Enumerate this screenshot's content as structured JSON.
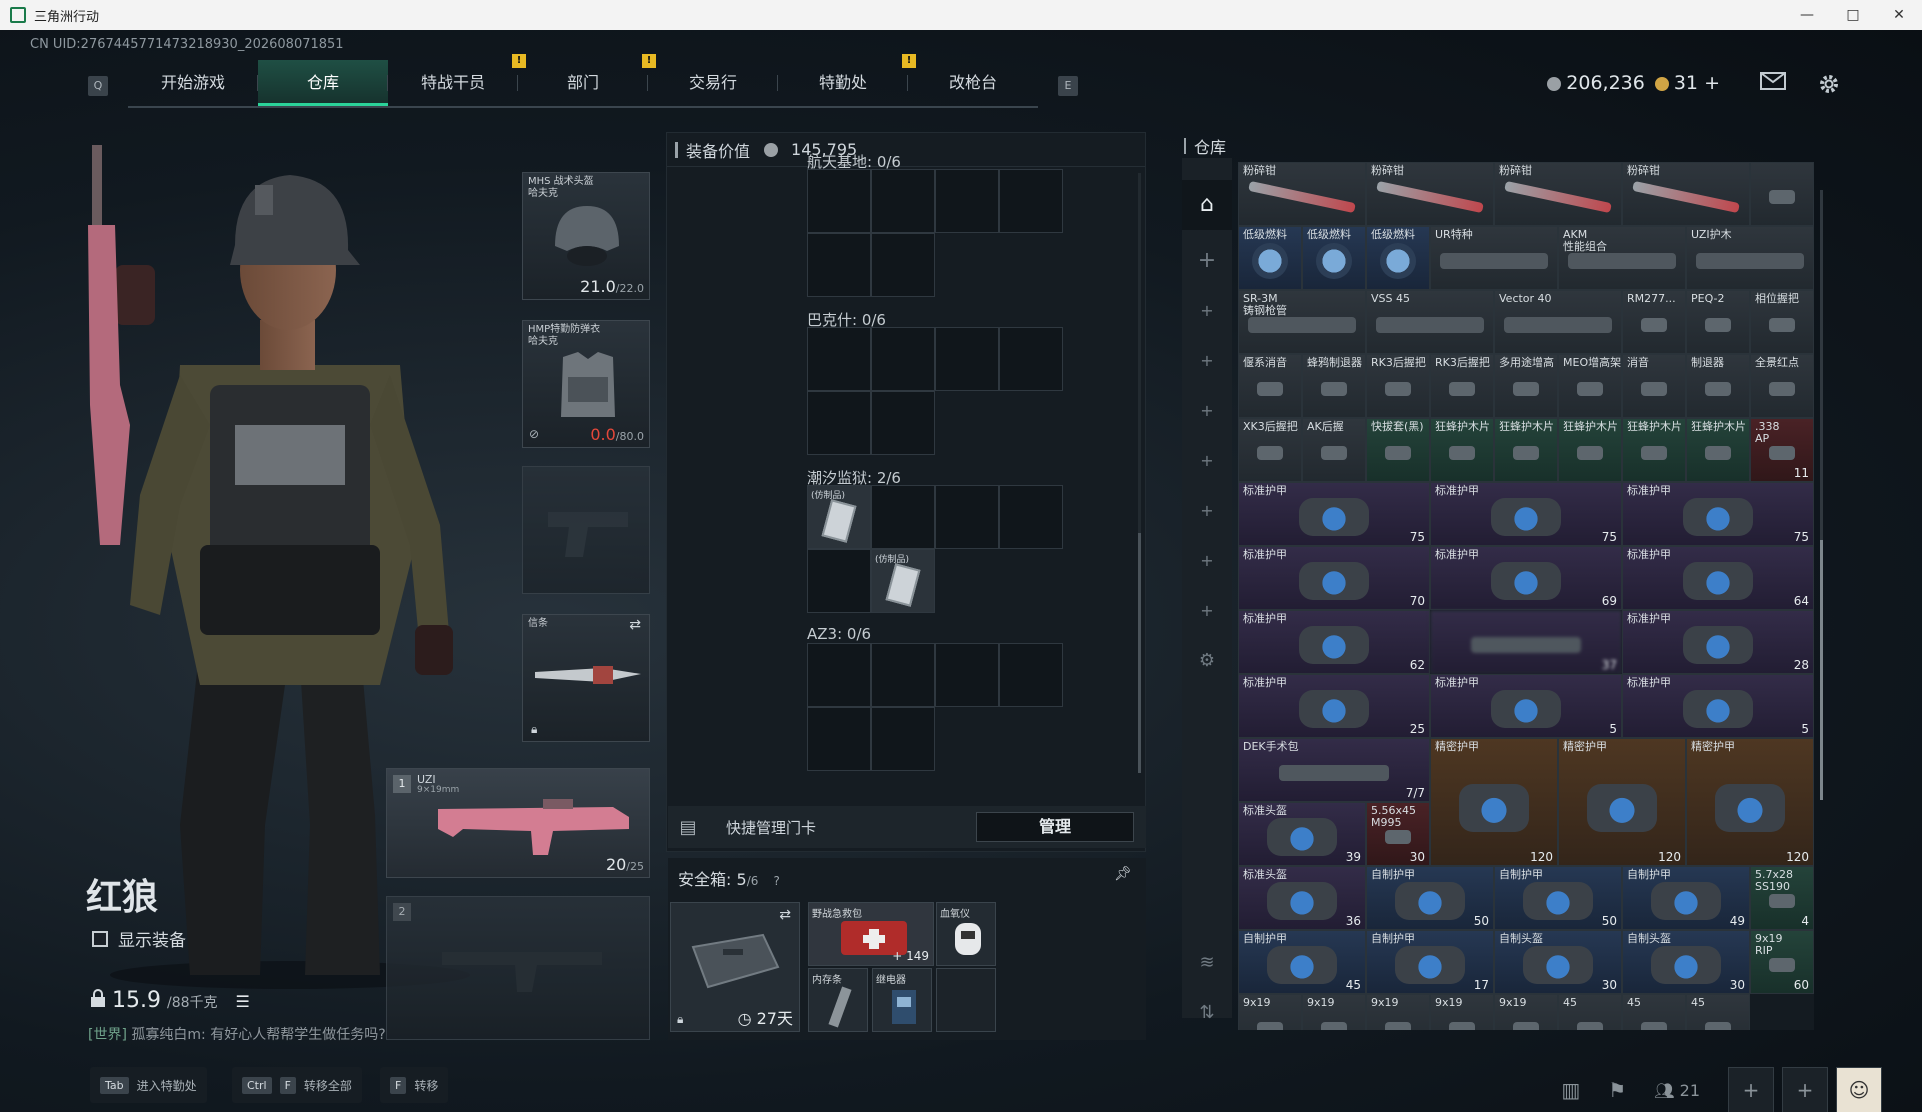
{
  "window": {
    "title": "三角洲行动",
    "controls": [
      "—",
      "□",
      "✕"
    ]
  },
  "uid": "CN UID:2767445771473218930_202608071851",
  "nav": {
    "left_key": "Q",
    "right_key": "E",
    "tabs": [
      {
        "label": "开始游戏",
        "active": false,
        "alert": false
      },
      {
        "label": "仓库",
        "active": true,
        "alert": false
      },
      {
        "label": "特战干员",
        "active": false,
        "alert": true
      },
      {
        "label": "部门",
        "active": false,
        "alert": true
      },
      {
        "label": "交易行",
        "active": false,
        "alert": false
      },
      {
        "label": "特勤处",
        "active": false,
        "alert": true
      },
      {
        "label": "改枪台",
        "active": false,
        "alert": false
      }
    ],
    "alert_glyph": "!"
  },
  "currency": {
    "silver": "206,236",
    "gold": "31",
    "add": "+"
  },
  "character": {
    "name": "红狼",
    "show_equipment": "显示装备",
    "weight": "15.9",
    "weight_max": "/88千克"
  },
  "chat": {
    "channel": "[世界]",
    "message": "孤寡纯白m: 有好心人帮帮学生做任务吗?"
  },
  "equip": {
    "helmet": {
      "label": "MHS 战术头盔\n哈夫克",
      "dur": "21.0",
      "max": "/22.0"
    },
    "armor": {
      "label": "HMP特勤防弹衣\n哈夫克",
      "dur": "0.0",
      "max": "/80.0"
    },
    "melee": {
      "label": "信条"
    },
    "primary1": {
      "index": "1",
      "label": "UZI",
      "sub": "9×19mm",
      "ammo": "20",
      "ammo_max": "/25"
    },
    "primary2": {
      "index": "2"
    }
  },
  "center": {
    "value_label": "装备价值",
    "value": "145,795",
    "boxes": [
      {
        "title": "航天基地: 0/6"
      },
      {
        "title": "巴克什: 0/6"
      },
      {
        "title": "潮汐监狱: 2/6"
      },
      {
        "title": "AZ3: 0/6"
      }
    ],
    "card_item_label": "(仿制品)",
    "quick_card": "快捷管理门卡",
    "manage": "管理",
    "safe_title": "安全箱:",
    "safe_count": "5",
    "safe_max": "/6",
    "safe_help": "?",
    "safe_days": "27天",
    "safe_items": [
      {
        "label": "野战急救包",
        "count": "149"
      },
      {
        "label": "血氧仪",
        "count": ""
      },
      {
        "label": "内存条",
        "count": ""
      },
      {
        "label": "继电器",
        "count": ""
      }
    ]
  },
  "warehouse": {
    "title": "仓库",
    "items": [
      {
        "label": "粉碎钳",
        "count": "",
        "tone": "gray"
      },
      {
        "label": "粉碎钳",
        "count": "",
        "tone": "gray"
      },
      {
        "label": "粉碎钳",
        "count": "",
        "tone": "gray"
      },
      {
        "label": "粉碎钳",
        "count": "",
        "tone": "gray"
      },
      {
        "label": "",
        "count": "",
        "tone": "gray"
      },
      {
        "label": "低级燃料",
        "count": "",
        "tone": "blue"
      },
      {
        "label": "低级燃料",
        "count": "",
        "tone": "blue"
      },
      {
        "label": "低级燃料",
        "count": "",
        "tone": "blue"
      },
      {
        "label": "UR特种",
        "count": "",
        "tone": "gray"
      },
      {
        "label": "AKM\n性能组合",
        "count": "",
        "tone": "gray"
      },
      {
        "label": "UZI护木",
        "count": "",
        "tone": "gray"
      },
      {
        "label": "SR-3M\n铸钢枪管",
        "count": "",
        "tone": "gray"
      },
      {
        "label": "VSS 45",
        "count": "",
        "tone": "gray"
      },
      {
        "label": "Vector 40",
        "count": "",
        "tone": "gray"
      },
      {
        "label": "RM277...",
        "count": "",
        "tone": "gray"
      },
      {
        "label": "PEQ-2",
        "count": "",
        "tone": "gray"
      },
      {
        "label": "相位握把",
        "count": "",
        "tone": "gray"
      },
      {
        "label": "偃系消音",
        "count": "",
        "tone": "gray"
      },
      {
        "label": "蜂鸦制退器",
        "count": "",
        "tone": "gray"
      },
      {
        "label": "RK3后握把",
        "count": "",
        "tone": "gray"
      },
      {
        "label": "RK3后握把",
        "count": "",
        "tone": "gray"
      },
      {
        "label": "多用途增高",
        "count": "",
        "tone": "gray"
      },
      {
        "label": "MEO增高架",
        "count": "",
        "tone": "gray"
      },
      {
        "label": "消音",
        "count": "",
        "tone": "gray"
      },
      {
        "label": "制退器",
        "count": "",
        "tone": "gray"
      },
      {
        "label": "全景红点",
        "count": "",
        "tone": "gray"
      },
      {
        "label": "XK3后握把",
        "count": "",
        "tone": "gray"
      },
      {
        "label": "AK后握",
        "count": "",
        "tone": "gray"
      },
      {
        "label": "快拔套(黑)",
        "count": "",
        "tone": "green"
      },
      {
        "label": "狂蜂护木片",
        "count": "",
        "tone": "green"
      },
      {
        "label": "狂蜂护木片",
        "count": "",
        "tone": "green"
      },
      {
        "label": "狂蜂护木片",
        "count": "",
        "tone": "green"
      },
      {
        "label": "狂蜂护木片",
        "count": "",
        "tone": "green"
      },
      {
        "label": "狂蜂护木片",
        "count": "",
        "tone": "green"
      },
      {
        "label": ".338\nAP",
        "count": "11",
        "tone": "red"
      },
      {
        "label": "标准护甲",
        "count": "75",
        "tone": "purple"
      },
      {
        "label": "标准护甲",
        "count": "75",
        "tone": "purple"
      },
      {
        "label": "标准护甲",
        "count": "75",
        "tone": "purple"
      },
      {
        "label": "标准护甲",
        "count": "70",
        "tone": "purple"
      },
      {
        "label": "标准护甲",
        "count": "69",
        "tone": "purple"
      },
      {
        "label": "标准护甲",
        "count": "64",
        "tone": "purple"
      },
      {
        "label": "标准护甲",
        "count": "62",
        "tone": "purple"
      },
      {
        "label": "",
        "count": "37",
        "tone": "purple"
      },
      {
        "label": "标准护甲",
        "count": "28",
        "tone": "purple"
      },
      {
        "label": "标准护甲",
        "count": "25",
        "tone": "purple"
      },
      {
        "label": "标准护甲",
        "count": "5",
        "tone": "purple"
      },
      {
        "label": "标准护甲",
        "count": "5",
        "tone": "purple"
      },
      {
        "label": "DEK手术包",
        "count": "7/7",
        "tone": "purple"
      },
      {
        "label": "精密护甲",
        "count": "120",
        "tone": "orange"
      },
      {
        "label": "精密护甲",
        "count": "120",
        "tone": "orange"
      },
      {
        "label": "精密护甲",
        "count": "120",
        "tone": "orange"
      },
      {
        "label": "标准头盔",
        "count": "39",
        "tone": "purple"
      },
      {
        "label": "5.56x45\nM995",
        "count": "30",
        "tone": "red"
      },
      {
        "label": "标准头盔",
        "count": "36",
        "tone": "purple"
      },
      {
        "label": "自制护甲",
        "count": "50",
        "tone": "blue"
      },
      {
        "label": "自制护甲",
        "count": "50",
        "tone": "blue"
      },
      {
        "label": "自制护甲",
        "count": "49",
        "tone": "blue"
      },
      {
        "label": "5.7x28\nSS190",
        "count": "4",
        "tone": "green"
      },
      {
        "label": "自制护甲",
        "count": "45",
        "tone": "blue"
      },
      {
        "label": "自制护甲",
        "count": "17",
        "tone": "blue"
      },
      {
        "label": "自制头盔",
        "count": "30",
        "tone": "blue"
      },
      {
        "label": "自制头盔",
        "count": "30",
        "tone": "blue"
      },
      {
        "label": "9x19\nRIP",
        "count": "60",
        "tone": "green"
      },
      {
        "label": "9x19",
        "count": "",
        "tone": "gray"
      },
      {
        "label": "9x19",
        "count": "",
        "tone": "gray"
      },
      {
        "label": "9x19",
        "count": "",
        "tone": "gray"
      },
      {
        "label": "9x19",
        "count": "",
        "tone": "gray"
      },
      {
        "label": "9x19",
        "count": "",
        "tone": "gray"
      },
      {
        "label": "45",
        "count": "",
        "tone": "gray"
      },
      {
        "label": "45",
        "count": "",
        "tone": "gray"
      },
      {
        "label": "45",
        "count": "",
        "tone": "gray"
      }
    ]
  },
  "hotkeys": [
    {
      "keys": [
        "Tab"
      ],
      "label": "进入特勤处"
    },
    {
      "keys": [
        "Ctrl",
        "F"
      ],
      "label": "转移全部"
    },
    {
      "keys": [
        "F"
      ],
      "label": "转移"
    }
  ],
  "bottom_right": {
    "friends": "21"
  },
  "colors": {
    "accent": "#2bd39a",
    "alert": "#e8b923",
    "danger": "#e5483a"
  }
}
